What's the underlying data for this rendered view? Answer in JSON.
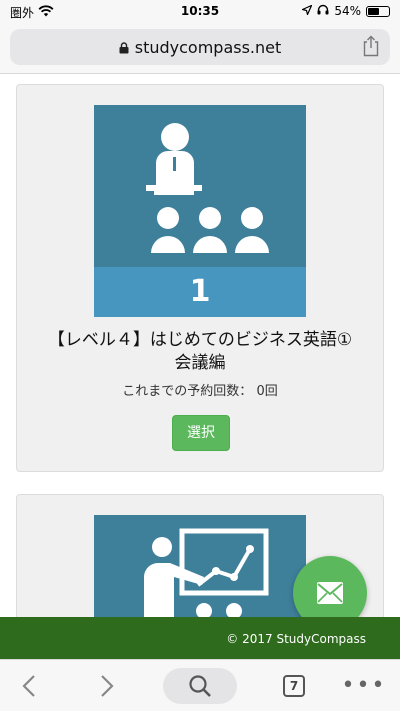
{
  "status_bar": {
    "carrier": "圏外",
    "time": "10:35",
    "battery_percent": "54%",
    "battery_level": 0.54
  },
  "browser": {
    "url": "studycompass.net",
    "tab_count": "7"
  },
  "lessons": [
    {
      "number": "1",
      "title": "【レベル４】はじめてのビジネス英語①　会議編",
      "reserve_label": "これまでの予約回数：",
      "reserve_count": "0回",
      "select_label": "選択"
    }
  ],
  "footer": {
    "copyright": "© 2017 StudyCompass"
  },
  "colors": {
    "thumb_bg": "#3e7f9a",
    "thumb_band": "#4696c0",
    "select_green": "#5cb85c",
    "footer_green": "#2e6b1c"
  },
  "icons": [
    "wifi-icon",
    "location-arrow-icon",
    "headphones-icon",
    "battery-icon",
    "lock-icon",
    "share-icon",
    "presenter-audience-icon",
    "presenter-chart-icon",
    "mail-icon",
    "back-icon",
    "forward-icon",
    "search-icon",
    "tabs-icon",
    "more-icon"
  ]
}
